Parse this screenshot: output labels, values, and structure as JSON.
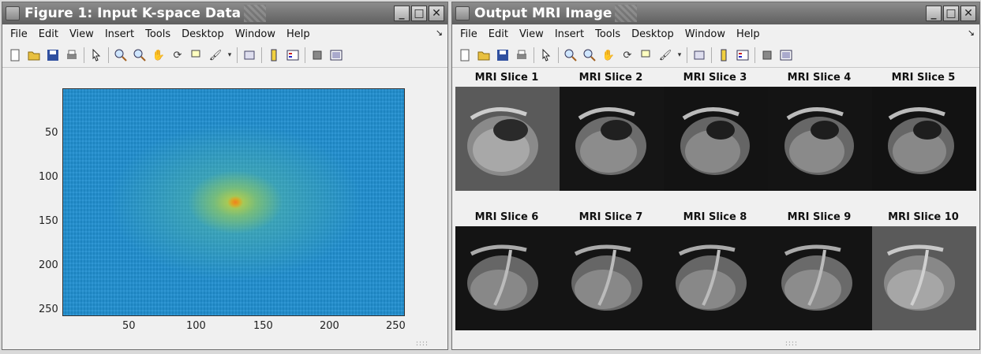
{
  "window1": {
    "title": "Figure 1: Input K-space Data",
    "buttons": [
      "_",
      "□",
      "✕"
    ],
    "menu": [
      "File",
      "Edit",
      "View",
      "Insert",
      "Tools",
      "Desktop",
      "Window",
      "Help"
    ],
    "yticks": [
      "50",
      "100",
      "150",
      "200",
      "250"
    ],
    "xticks": [
      "50",
      "100",
      "150",
      "200",
      "250"
    ]
  },
  "window2": {
    "title": "Output MRI Image",
    "buttons": [
      "_",
      "□",
      "✕"
    ],
    "menu": [
      "File",
      "Edit",
      "View",
      "Insert",
      "Tools",
      "Desktop",
      "Window",
      "Help"
    ],
    "slices": [
      "MRI Slice 1",
      "MRI Slice 2",
      "MRI Slice 3",
      "MRI Slice 4",
      "MRI Slice 5",
      "MRI Slice 6",
      "MRI Slice 7",
      "MRI Slice 8",
      "MRI Slice 9",
      "MRI Slice 10"
    ]
  },
  "toolbar_icons": [
    "new-file-icon",
    "open-folder-icon",
    "save-icon",
    "print-icon",
    "pointer-icon",
    "zoom-in-icon",
    "zoom-out-icon",
    "pan-hand-icon",
    "rotate-icon",
    "data-cursor-icon",
    "brush-icon",
    "link-icon",
    "colorbar-icon",
    "legend-icon",
    "hide-plot-tools-icon",
    "show-plot-tools-icon"
  ]
}
